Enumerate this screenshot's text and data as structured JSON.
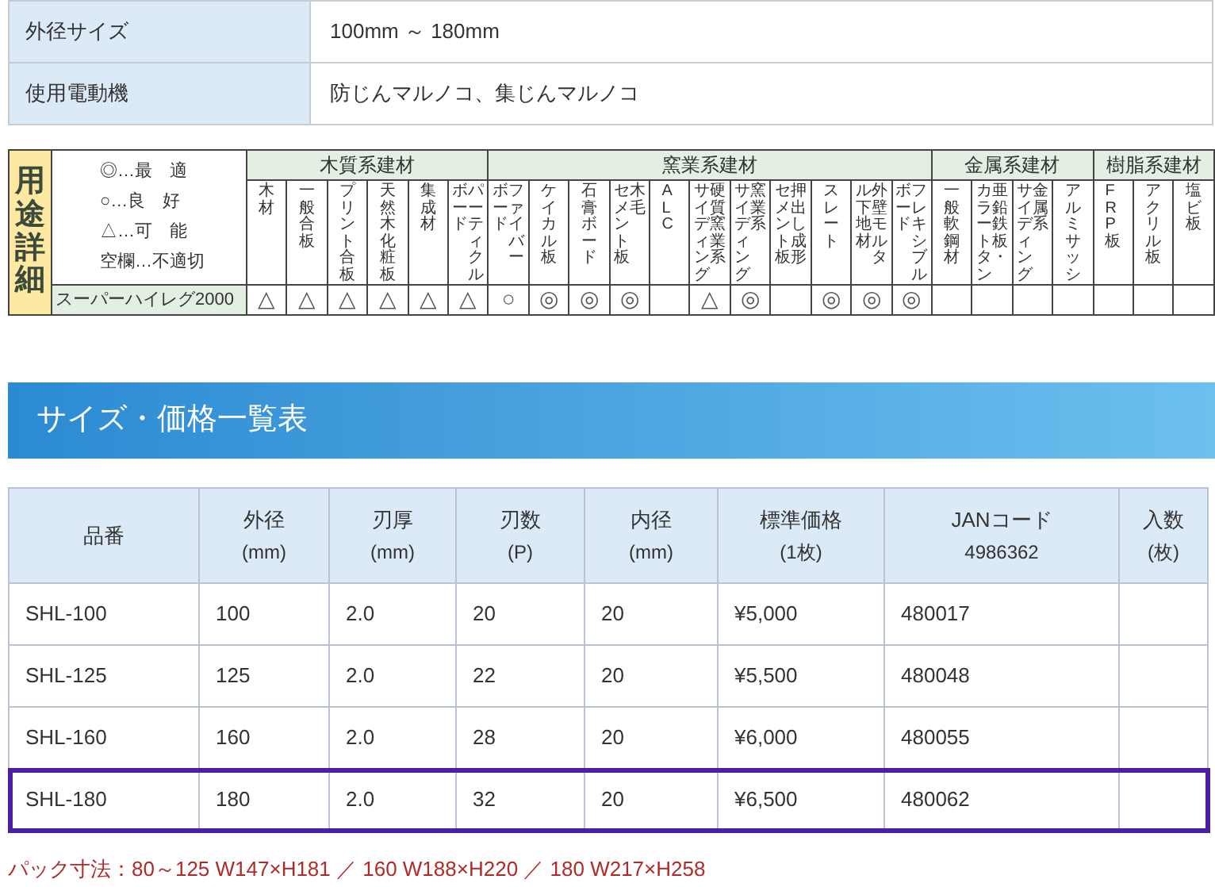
{
  "spec_table": [
    {
      "label": "外径サイズ",
      "value": "100mm ～ 180mm"
    },
    {
      "label": "使用電動機",
      "value": "防じんマルノコ、集じんマルノコ"
    }
  ],
  "usage": {
    "title": "用途詳細",
    "legend": [
      "◎…最　適",
      "○…良　好",
      "△…可　能",
      "空欄…不適切"
    ],
    "product": "スーパーハイレグ2000",
    "groups": [
      {
        "name": "木質系建材",
        "columns": [
          {
            "lines": [
              "木材"
            ],
            "mark": "△"
          },
          {
            "lines": [
              "一般合板"
            ],
            "mark": "△"
          },
          {
            "lines": [
              "プリント合板"
            ],
            "mark": "△"
          },
          {
            "lines": [
              "天然木化粧板"
            ],
            "mark": "△"
          },
          {
            "lines": [
              "集成材"
            ],
            "mark": "△"
          },
          {
            "lines": [
              "ボード",
              "パーティクル"
            ],
            "mark": "△"
          }
        ]
      },
      {
        "name": "窯業系建材",
        "columns": [
          {
            "lines": [
              "ボード",
              "ファイバー"
            ],
            "mark": "○"
          },
          {
            "lines": [
              "ケイカル板"
            ],
            "mark": "◎"
          },
          {
            "lines": [
              "石膏ボード"
            ],
            "mark": "◎"
          },
          {
            "lines": [
              "セメント板",
              "木毛"
            ],
            "mark": "◎"
          },
          {
            "lines": [
              "ALC"
            ]
          },
          {
            "lines": [
              "サイディング",
              "硬質窯業系"
            ],
            "mark": "△"
          },
          {
            "lines": [
              "サイディング",
              "窯業系"
            ],
            "mark": "◎"
          },
          {
            "lines": [
              "セメント板",
              "押出し成形"
            ]
          },
          {
            "lines": [
              "スレート"
            ],
            "mark": "◎"
          },
          {
            "lines": [
              "ル下地材",
              "外壁モルタ"
            ],
            "mark": "◎"
          },
          {
            "lines": [
              "ボード",
              "フレキシブル"
            ],
            "mark": "◎"
          }
        ]
      },
      {
        "name": "金属系建材",
        "columns": [
          {
            "lines": [
              "一般軟鋼材"
            ]
          },
          {
            "lines": [
              "カラートタン",
              "亜鉛鉄板・"
            ]
          },
          {
            "lines": [
              "サイディング",
              "金属系"
            ]
          },
          {
            "lines": [
              "アルミサッシ"
            ]
          }
        ]
      },
      {
        "name": "樹脂系建材",
        "columns": [
          {
            "lines": [
              "FRP板"
            ]
          },
          {
            "lines": [
              "アクリル板"
            ]
          },
          {
            "lines": [
              "塩ビ板"
            ]
          }
        ]
      }
    ]
  },
  "banner": "サイズ・価格一覧表",
  "price_table": {
    "columns": [
      {
        "name": "品番"
      },
      {
        "name": "外径",
        "sub": "(mm)"
      },
      {
        "name": "刃厚",
        "sub": "(mm)"
      },
      {
        "name": "刃数",
        "sub": "(P)"
      },
      {
        "name": "内径",
        "sub": "(mm)"
      },
      {
        "name": "標準価格",
        "sub": "(1枚)"
      },
      {
        "name": "JANコード",
        "sub": "4986362"
      },
      {
        "name": "入数",
        "sub": "(枚)"
      }
    ],
    "rows": [
      {
        "cells": [
          "SHL-100",
          "100",
          "2.0",
          "20",
          "20",
          "¥5,000",
          "480017"
        ],
        "selected": false
      },
      {
        "cells": [
          "SHL-125",
          "125",
          "2.0",
          "22",
          "20",
          "¥5,500",
          "480048"
        ],
        "selected": false
      },
      {
        "cells": [
          "SHL-160",
          "160",
          "2.0",
          "28",
          "20",
          "¥6,000",
          "480055"
        ],
        "selected": false
      },
      {
        "cells": [
          "SHL-180",
          "180",
          "2.0",
          "32",
          "20",
          "¥6,500",
          "480062"
        ],
        "selected": true
      }
    ]
  },
  "note": "パック寸法：80～125 W147×H181 ／ 160 W188×H220 ／ 180 W217×H258"
}
